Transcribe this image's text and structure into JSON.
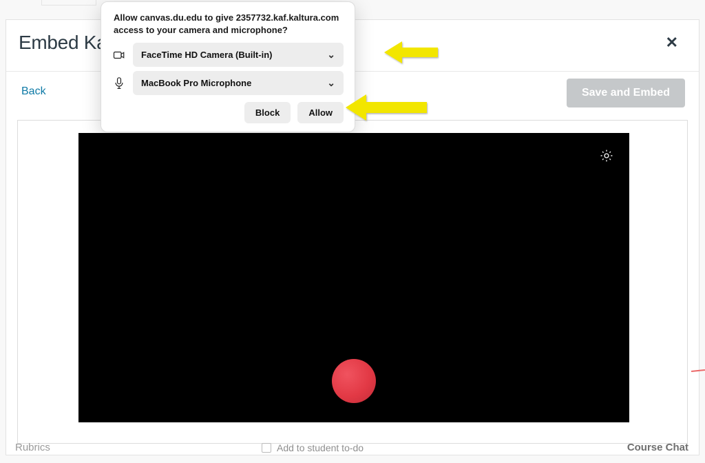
{
  "header": {
    "title": "Embed Kal",
    "close_symbol": "✕"
  },
  "toolbar": {
    "back_label": "Back",
    "save_label": "Save and Embed"
  },
  "dialog": {
    "message": "Allow canvas.du.edu to give 2357732.kaf.kaltura.com access to your camera and microphone?",
    "camera_value": "FaceTime HD Camera (Built-in)",
    "mic_value": "MacBook Pro Microphone",
    "block_label": "Block",
    "allow_label": "Allow"
  },
  "footer": {
    "left_text": "Rubrics",
    "checkbox_label": "Add to student to-do",
    "right_text": "Course Chat"
  }
}
